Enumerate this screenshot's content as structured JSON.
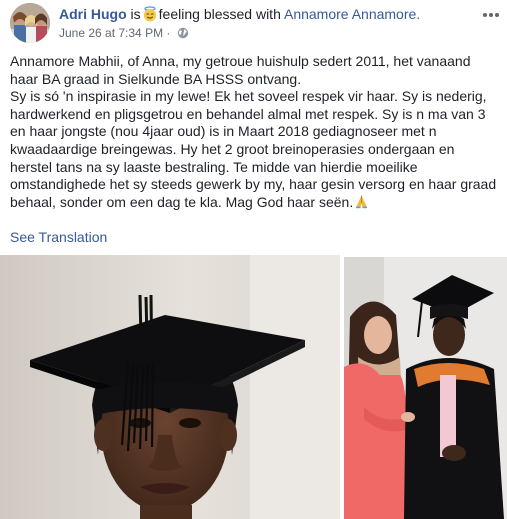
{
  "post": {
    "author": "Adri Hugo",
    "is_text": "is",
    "feeling_text": "feeling blessed with",
    "tagged": "Annamore Annamore.",
    "date": "June 26 at 7:34 PM",
    "separator": "·",
    "paragraph1": "Annamore Mabhii, of Anna, my getroue huishulp sedert 2011, het vanaand haar BA graad in Sielkunde BA HSSS ontvang.",
    "paragraph2": "Sy is só 'n inspirasie in my lewe! Ek het soveel respek vir haar. Sy is nederig, hardwerkend en pligsgetrou en behandel almal met respek. Sy is n ma van 3 en haar jongste (nou 4jaar oud) is in Maart 2018 gediagnoseer met n kwaadaardige breingewas. Hy het 2 groot breinoperasies ondergaan en herstel tans na sy laaste bestraling. Te midde van hierdie moeilike omstandighede het sy steeds gewerk by my, haar gesin versorg en haar graad behaal, sonder om een dag te kla. Mag God haar seën.",
    "see_translation": "See Translation"
  },
  "icons": {
    "feeling": "smiling-face-with-halo-icon",
    "privacy": "globe-icon",
    "more": "more-options-icon",
    "pray": "folded-hands-icon"
  },
  "colors": {
    "link": "#385898",
    "text": "#1d2129",
    "meta": "#616770"
  }
}
